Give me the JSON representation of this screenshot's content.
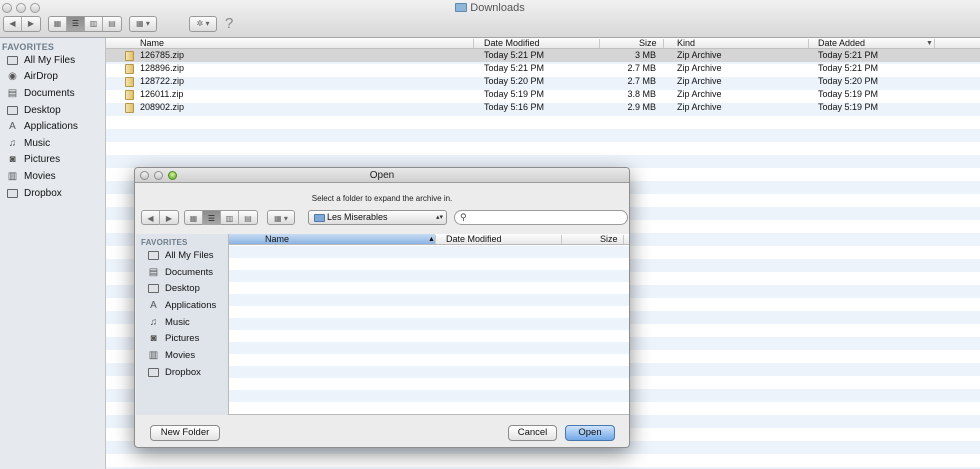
{
  "window": {
    "title": "Downloads"
  },
  "toolbar": {
    "back_glyph": "◀",
    "forward_glyph": "▶",
    "action_glyph": "✲",
    "help_glyph": "?"
  },
  "sidebar": {
    "header": "FAVORITES",
    "items": [
      {
        "label": "All My Files",
        "icon": "all-files-icon"
      },
      {
        "label": "AirDrop",
        "icon": "airdrop-icon"
      },
      {
        "label": "Documents",
        "icon": "documents-icon"
      },
      {
        "label": "Desktop",
        "icon": "desktop-icon"
      },
      {
        "label": "Applications",
        "icon": "applications-icon"
      },
      {
        "label": "Music",
        "icon": "music-icon"
      },
      {
        "label": "Pictures",
        "icon": "pictures-icon"
      },
      {
        "label": "Movies",
        "icon": "movies-icon"
      },
      {
        "label": "Dropbox",
        "icon": "dropbox-folder-icon"
      }
    ]
  },
  "file_list": {
    "columns": {
      "name": "Name",
      "date_modified": "Date Modified",
      "size": "Size",
      "kind": "Kind",
      "date_added": "Date Added"
    },
    "rows": [
      {
        "name": "126785.zip",
        "date_modified": "Today 5:21 PM",
        "size": "3 MB",
        "kind": "Zip Archive",
        "date_added": "Today 5:21 PM"
      },
      {
        "name": "128896.zip",
        "date_modified": "Today 5:21 PM",
        "size": "2.7 MB",
        "kind": "Zip Archive",
        "date_added": "Today 5:21 PM"
      },
      {
        "name": "128722.zip",
        "date_modified": "Today 5:20 PM",
        "size": "2.7 MB",
        "kind": "Zip Archive",
        "date_added": "Today 5:20 PM"
      },
      {
        "name": "126011.zip",
        "date_modified": "Today 5:19 PM",
        "size": "3.8 MB",
        "kind": "Zip Archive",
        "date_added": "Today 5:19 PM"
      },
      {
        "name": "208902.zip",
        "date_modified": "Today 5:16 PM",
        "size": "2.9 MB",
        "kind": "Zip Archive",
        "date_added": "Today 5:19 PM"
      }
    ]
  },
  "dialog": {
    "title": "Open",
    "message": "Select a folder to expand the archive in.",
    "location": "Les Miserables",
    "search_placeholder": "",
    "sidebar": {
      "header": "FAVORITES",
      "items": [
        {
          "label": "All My Files",
          "icon": "all-files-icon"
        },
        {
          "label": "Documents",
          "icon": "documents-icon"
        },
        {
          "label": "Desktop",
          "icon": "desktop-icon"
        },
        {
          "label": "Applications",
          "icon": "applications-icon"
        },
        {
          "label": "Music",
          "icon": "music-icon"
        },
        {
          "label": "Pictures",
          "icon": "pictures-icon"
        },
        {
          "label": "Movies",
          "icon": "movies-icon"
        },
        {
          "label": "Dropbox",
          "icon": "dropbox-folder-icon"
        }
      ]
    },
    "columns": {
      "name": "Name",
      "date_modified": "Date Modified",
      "size": "Size"
    },
    "buttons": {
      "new_folder": "New Folder",
      "cancel": "Cancel",
      "open": "Open"
    }
  }
}
